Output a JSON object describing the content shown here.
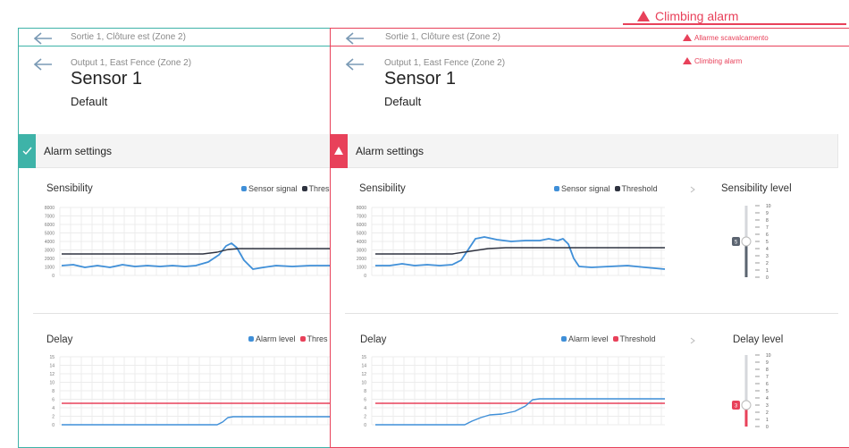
{
  "banner": {
    "alarm_label": "Climbing alarm"
  },
  "left": {
    "top_crumb": "Sortie 1, Clôture est (Zone 2)",
    "crumb": "Output 1, East Fence (Zone 2)",
    "title": "Sensor 1",
    "subtitle": "Default",
    "section": "Alarm settings",
    "sens_title": "Sensibility",
    "sens_legend": [
      "Sensor signal",
      "Thres"
    ],
    "delay_title": "Delay",
    "delay_legend": [
      "Alarm level",
      "Thres"
    ]
  },
  "right": {
    "top_crumb": "Sortie 1, Clôture est (Zone 2)",
    "top_alarm": "Allarme scavalcamento",
    "crumb": "Output 1, East Fence (Zone 2)",
    "alarm": "Climbing alarm",
    "title": "Sensor 1",
    "subtitle": "Default",
    "section": "Alarm settings",
    "sens_title": "Sensibility",
    "sens_legend": [
      "Sensor signal",
      "Threshold"
    ],
    "sens_level_title": "Sensibility level",
    "sens_level_value": "5",
    "delay_title": "Delay",
    "delay_legend": [
      "Alarm level",
      "Threshold"
    ],
    "delay_level_title": "Delay level",
    "delay_level_value": "3"
  },
  "colors": {
    "teal": "#3eb3a8",
    "red": "#e8415a",
    "blue": "#3f8fd8",
    "dark": "#2f3340",
    "slider": "#5b6470"
  },
  "sens_axis": [
    "8000",
    "7000",
    "6000",
    "5000",
    "4000",
    "3000",
    "2000",
    "1000",
    "0"
  ],
  "delay_axis": [
    "15",
    "14",
    "12",
    "10",
    "8",
    "6",
    "4",
    "2",
    "0"
  ],
  "level_axis": [
    "10",
    "9",
    "8",
    "7",
    "6",
    "5",
    "4",
    "3",
    "2",
    "1",
    "0"
  ],
  "icons": {
    "back": "back-arrow-icon",
    "check": "check-icon",
    "warning": "warning-icon",
    "chevron": "chevron-right-icon"
  }
}
